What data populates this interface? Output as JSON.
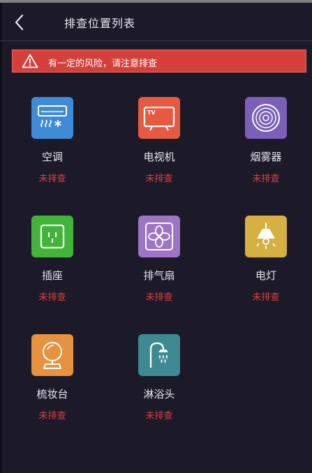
{
  "header": {
    "title": "排查位置列表"
  },
  "warning": {
    "text": "有一定的风险，请注意排查"
  },
  "colors": {
    "background": "#1c1929",
    "warning_bg": "#d6403a",
    "status_text": "#d8433c"
  },
  "items": [
    {
      "label": "空调",
      "status": "未排查",
      "icon": "air-conditioner-icon",
      "color": "#3f8bd6"
    },
    {
      "label": "电视机",
      "status": "未排查",
      "icon": "tv-icon",
      "color": "#e65a42"
    },
    {
      "label": "烟雾器",
      "status": "未排查",
      "icon": "smoke-detector-icon",
      "color": "#7b5fb8"
    },
    {
      "label": "插座",
      "status": "未排查",
      "icon": "socket-icon",
      "color": "#43b43a"
    },
    {
      "label": "排气扇",
      "status": "未排查",
      "icon": "exhaust-fan-icon",
      "color": "#9e74c4"
    },
    {
      "label": "电灯",
      "status": "未排查",
      "icon": "lamp-icon",
      "color": "#d6b040"
    },
    {
      "label": "梳妆台",
      "status": "未排查",
      "icon": "dresser-mirror-icon",
      "color": "#e6923e"
    },
    {
      "label": "淋浴头",
      "status": "未排查",
      "icon": "shower-head-icon",
      "color": "#3f8a92"
    }
  ]
}
